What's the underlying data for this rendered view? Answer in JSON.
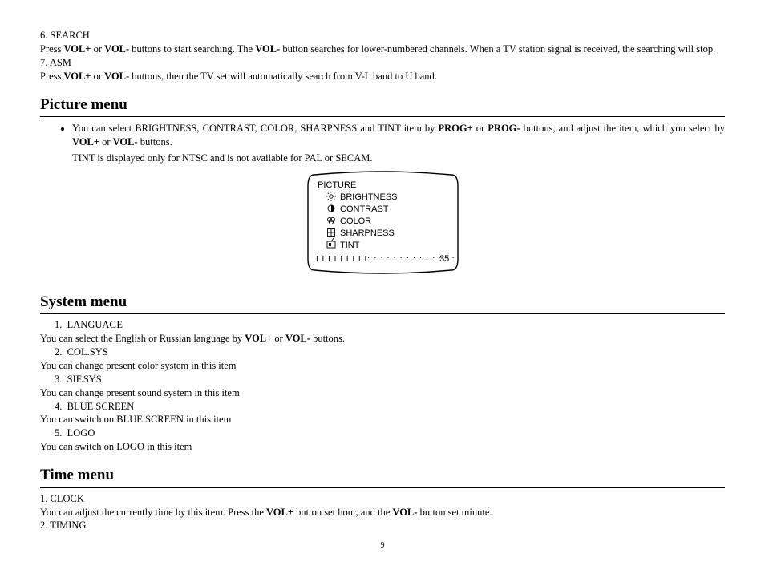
{
  "intro": {
    "item6_num": "6.",
    "item6_title": "SEARCH",
    "item6_press": "Press ",
    "item6_b1": "VOL+",
    "item6_mid1": " or ",
    "item6_b2": "VOL-",
    "item6_mid2": " buttons to start searching. The ",
    "item6_b3": "VOL-",
    "item6_tail": " button searches for lower-numbered channels. When a TV station signal is received, the searching will stop.",
    "item7_num": "7.",
    "item7_title": "ASM",
    "item7_press": "Press ",
    "item7_b1": "VOL+",
    "item7_mid1": " or ",
    "item7_b2": "VOL-",
    "item7_tail": " buttons, then the TV set will automatically search from V-L band to U band."
  },
  "picture": {
    "heading": "Picture menu",
    "bullet_lead": "You can select BRIGHTNESS, CONTRAST, COLOR, SHARPNESS and TINT item by ",
    "bullet_b1": "PROG+",
    "bullet_mid1": " or ",
    "bullet_b2": "PROG-",
    "bullet_mid2": " buttons, and adjust the item, which you select by ",
    "bullet_b3": "VOL+",
    "bullet_mid3": " or ",
    "bullet_b4": "VOL-",
    "bullet_tail": " buttons.",
    "tint_note": "TINT is displayed only for NTSC and is not available for PAL or SECAM.",
    "osd_title": "PICTURE",
    "osd_items": [
      "BRIGHTNESS",
      "CONTRAST",
      "COLOR",
      "SHARPNESS",
      "TINT"
    ],
    "osd_bar": "I I I I I I I I I",
    "osd_dots": "· · · · · · · · · · · · · ·",
    "osd_value": "35"
  },
  "system": {
    "heading": "System menu",
    "item1_num": "1.",
    "item1_title": "LANGUAGE",
    "item1_lead": "You can select the English or Russian language by ",
    "item1_b1": "VOL+",
    "item1_mid": " or ",
    "item1_b2": "VOL-",
    "item1_tail": " buttons.",
    "item2_num": "2.",
    "item2_title": "COL.SYS",
    "item2_body": "You can change present color system in this item",
    "item3_num": "3.",
    "item3_title": "SIF.SYS",
    "item3_body": "You can change present sound system in this item",
    "item4_num": "4.",
    "item4_title": "BLUE SCREEN",
    "item4_body": "You can switch on BLUE SCREEN  in this item",
    "item5_num": "5.",
    "item5_title": "LOGO",
    "item5_body": "You can switch on LOGO  in this item"
  },
  "time": {
    "heading": "Time menu",
    "item1_num": "1.",
    "item1_title": "CLOCK",
    "item1_lead": "You can adjust the currently time by this item. Press the ",
    "item1_b1": "VOL+",
    "item1_mid1": " button set hour, and the ",
    "item1_b2": "VOL-",
    "item1_tail": " button set minute.",
    "item2_num": "2.",
    "item2_title": "TIMING"
  },
  "page_number": "9",
  "chart_data": {
    "type": "table",
    "title": "PICTURE",
    "rows": [
      "BRIGHTNESS",
      "CONTRAST",
      "COLOR",
      "SHARPNESS",
      "TINT"
    ],
    "slider_value": 35,
    "slider_min": 0,
    "slider_max": 100
  }
}
